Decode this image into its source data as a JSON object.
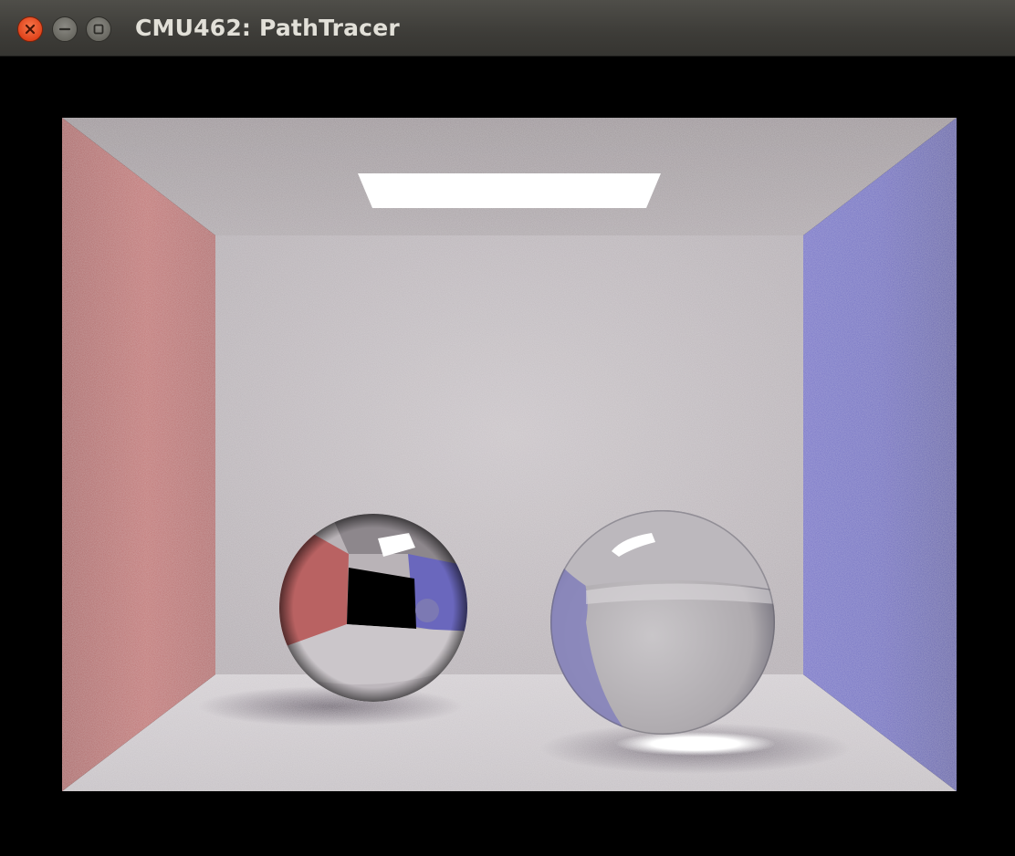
{
  "window": {
    "title": "CMU462: PathTracer",
    "controls": [
      {
        "name": "close",
        "icon": "close-icon"
      },
      {
        "name": "minimize",
        "icon": "minimize-icon"
      },
      {
        "name": "maximize",
        "icon": "maximize-icon"
      }
    ]
  },
  "scene": {
    "colors": {
      "left_wall": "#b86565",
      "right_wall": "#6a68c0",
      "back_wall": "#c2bcc0",
      "ceiling": "#a8a0a4",
      "floor": "#cdc8cc",
      "light": "#ffffff"
    }
  }
}
